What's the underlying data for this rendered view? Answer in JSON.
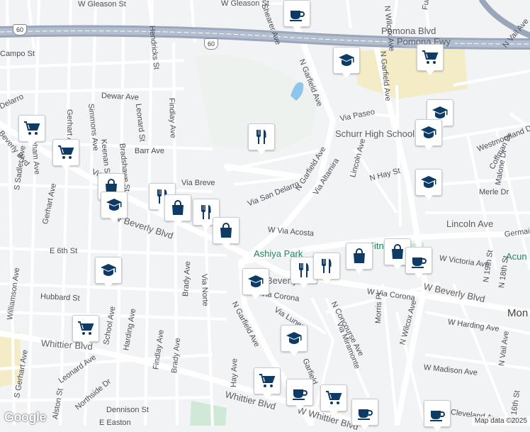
{
  "map": {
    "logo": "Google",
    "attribution": "Map data ©2025",
    "colors": {
      "background": "#f2f3f5",
      "road": "#ffffff",
      "freeway": "#9aa7bb",
      "park": "#cfe9d6",
      "water": "#8ec6ea",
      "school_area": "#f3ecc6",
      "pin_icon": "#0d3b66"
    },
    "street_labels": {
      "s1": "W Gleason St",
      "s2": "W Gleason St",
      "s3": "Pomona Blvd",
      "s4": "Pomona Fwy",
      "s5": "Campo St",
      "s6": "Dewar Ave",
      "s7": "Barr Ave",
      "s8": "Via Breve",
      "s9": "Via San Delarro",
      "s10": "N Garfield Ave",
      "s11": "N Garfield Ave",
      "s12": "Via Altamira",
      "s13": "Via Paseo",
      "s14": "Schurr High School",
      "s15": "Lincoln Ave",
      "s16": "N Hay St",
      "s17": "Merle Dr",
      "s18": "Lincoln Ave",
      "s19": "Germain",
      "s20": "Westmoreland Dr",
      "s21": "Coffman Dr",
      "s22": "Malone Dr",
      "s23": "W Via Acosta",
      "s24": "Ashiya Park",
      "s25": "Fitn",
      "s26": "W Victoria Ave",
      "s27": "Acun",
      "s28": "W Beverly Blvd",
      "s29": "Beverly Blvd",
      "s30": "W Beverly Blvd",
      "s31": "Mon",
      "s32": "W Via Corona",
      "s33": "Via Corona",
      "s34": "N Garfield Ave",
      "s35": "Via Lunes",
      "s36": "N Concourse Ave",
      "s37": "Via Miramonte",
      "s38": "Morris Pl",
      "s39": "N Wilcox Ave",
      "s40": "W Harding Ave",
      "s41": "W Madison Ave",
      "s42": "Whittier Blvd",
      "s43": "Whittier Blvd",
      "s44": "W Whittier Blvd",
      "s45": "E 6th St",
      "s46": "Hubbard St",
      "s47": "Gerhart Ave",
      "s48": "Gerhart Ave",
      "s49": "Twickenham Ave",
      "s50": "Simmons Ave",
      "s51": "Keenan St",
      "s52": "Bradshawe St",
      "s53": "Leonard St",
      "s54": "Hendricks St",
      "s55": "Findlay Ave",
      "s56": "S Sadler Ave",
      "s57": "Williamson Ave",
      "s58": "Brady Ave",
      "s59": "Via Norte",
      "s60": "School Ave",
      "s61": "Harding Ave",
      "s62": "Findlay Ave",
      "s63": "Brady Ave",
      "s64": "Hay Ave",
      "s65": "Leonard Ave",
      "s66": "Alston St",
      "s67": "Northside Dr",
      "s68": "Dennison St",
      "s69": "E Easton",
      "s70": "Garfield",
      "s71": "S Gerhart Ave",
      "s72": "Shearer Ave",
      "s73": "N Garfield Ave",
      "s74": "N Wilcox Ave",
      "s75": "Fulton",
      "s76": "N Vail Ave",
      "s77": "N Vail Ave",
      "s78": "N 19th St",
      "s79": "N 18th St",
      "s80": "N 16th St",
      "s81": "Cleveland Ave",
      "s82": "Delarro",
      "s83": "Beverly Blvd",
      "s84": "Via"
    },
    "highway_shields": {
      "h1": "60",
      "h2": "60"
    },
    "pins": [
      {
        "icon": "coffee-icon"
      },
      {
        "icon": "school-icon"
      },
      {
        "icon": "shopping-cart-icon"
      },
      {
        "icon": "school-icon"
      },
      {
        "icon": "school-icon"
      },
      {
        "icon": "school-icon"
      },
      {
        "icon": "shopping-cart-icon"
      },
      {
        "icon": "shopping-cart-icon"
      },
      {
        "icon": "restaurant-icon"
      },
      {
        "icon": "shopping-bag-icon"
      },
      {
        "icon": "school-icon"
      },
      {
        "icon": "restaurant-icon"
      },
      {
        "icon": "shopping-bag-icon"
      },
      {
        "icon": "restaurant-icon"
      },
      {
        "icon": "shopping-bag-icon"
      },
      {
        "icon": "school-icon"
      },
      {
        "icon": "restaurant-icon"
      },
      {
        "icon": "restaurant-icon"
      },
      {
        "icon": "shopping-bag-icon"
      },
      {
        "icon": "shopping-bag-icon"
      },
      {
        "icon": "coffee-icon"
      },
      {
        "icon": "shopping-cart-icon"
      },
      {
        "icon": "school-icon"
      },
      {
        "icon": "school-icon"
      },
      {
        "icon": "shopping-cart-icon"
      },
      {
        "icon": "coffee-icon"
      },
      {
        "icon": "shopping-cart-icon"
      },
      {
        "icon": "coffee-icon"
      },
      {
        "icon": "coffee-icon"
      }
    ]
  }
}
